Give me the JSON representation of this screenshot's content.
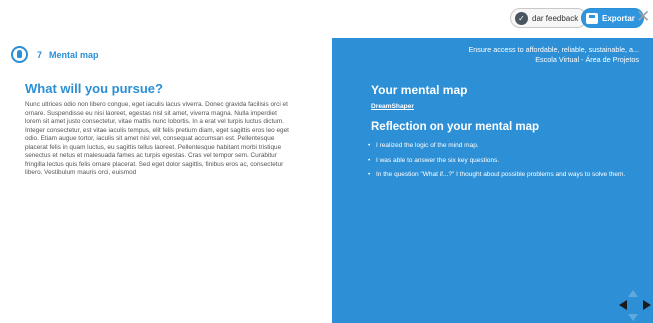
{
  "topbar": {
    "feedback_label": "dar feedback",
    "feedback_icon": "chat-check-icon",
    "export_label": "Exportar",
    "export_icon": "save-icon",
    "close_icon": "close-icon",
    "close_glyph": "✕"
  },
  "left": {
    "step_icon": "lightbulb-icon",
    "step_number": "7",
    "step_label": "Mental map",
    "title": "What will you pursue?",
    "body": "Nunc ultrices odio non libero congue, eget iaculis lacus viverra. Donec gravida facilisis orci et ornare. Suspendisse eu nisi laoreet, egestas nisl sit amet, viverra magna. Nulla imperdiet lorem sit amet justo consectetur, vitae mattis nunc lobortis. In a erat vel turpis luctus dictum. Integer consectetur, est vitae iaculis tempus, elit felis pretium diam, eget sagittis eros leo eget odio. Etiam augue tortor, iaculis sit amet nisl vel, consequat accumsan est. Pellentesque placerat felis in quam luctus, eu sagittis tellus laoreet. Pellentesque habitant morbi tristique senectus et netus et malesuada fames ac turpis egestas. Cras vel tempor sem. Curabitur fringilla lectus quis felis ornare placerat. Sed eget dolor sagittis, finibus eros ac, consectetur libero. Vestibulum mauris orci, euismod"
  },
  "right": {
    "org_line1": "Ensure access to affordable, reliable, sustainable, a...",
    "org_line2": "Escola Virtual - Área de Projetos",
    "title": "Your mental map",
    "link": "DreamShaper",
    "subtitle": "Reflection on your mental map",
    "items": [
      "I realized the logic of the mind map.",
      "I was able to answer the six key questions.",
      "In the question \"What if...?\" I thought about possible problems and ways to solve them."
    ]
  },
  "colors": {
    "accent": "#2b8fd6",
    "panel": "#2d8fd5",
    "nav_arrow_active": "#1b1b1b",
    "nav_arrow_inactive": "#5fa9df"
  },
  "navigation": {
    "icons": [
      "nav-up-icon",
      "nav-left-icon",
      "nav-right-icon",
      "nav-down-icon"
    ]
  }
}
